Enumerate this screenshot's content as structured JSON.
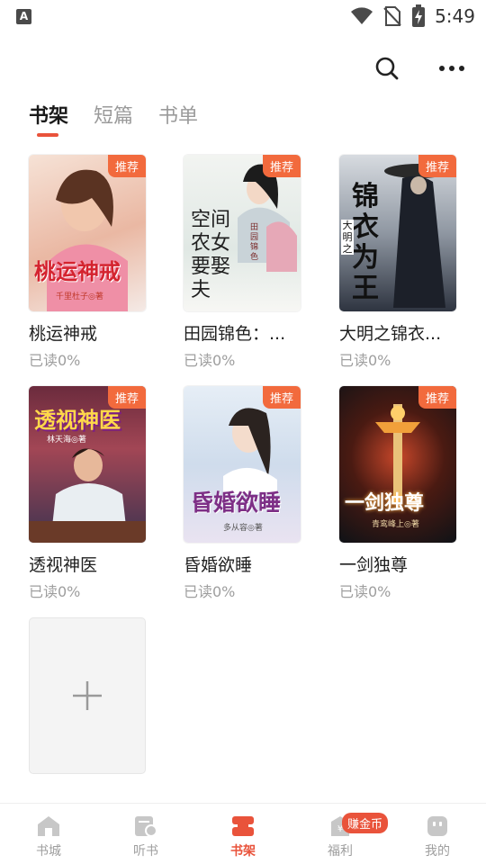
{
  "status_bar": {
    "time": "5:49",
    "left_icon": "A"
  },
  "header": {
    "search_icon": "search-icon",
    "more_icon": "more-icon"
  },
  "tabs": [
    {
      "label": "书架",
      "active": true
    },
    {
      "label": "短篇",
      "active": false
    },
    {
      "label": "书单",
      "active": false
    }
  ],
  "books": [
    {
      "title": "桃运神戒",
      "progress": "已读0%",
      "badge": "推荐",
      "cover_text": "桃运神戒",
      "cover_sub": "千里杜子◎著",
      "colors": [
        "#f3d7c8",
        "#e7a58f"
      ]
    },
    {
      "title": "田园锦色：...",
      "progress": "已读0%",
      "badge": "推荐",
      "cover_text": "空间农女要娶夫",
      "cover_sub": "田园锦色",
      "colors": [
        "#eef2ef",
        "#c9d6d1"
      ]
    },
    {
      "title": "大明之锦衣...",
      "progress": "已读0%",
      "badge": "推荐",
      "cover_text": "锦衣为王",
      "cover_sub": "大明之",
      "colors": [
        "#c7ccd3",
        "#3c4350"
      ]
    },
    {
      "title": "透视神医",
      "progress": "已读0%",
      "badge": "推荐",
      "cover_text": "透视神医",
      "cover_sub": "林天海◎著",
      "colors": [
        "#c04a59",
        "#35304f"
      ]
    },
    {
      "title": "昏婚欲睡",
      "progress": "已读0%",
      "badge": "推荐",
      "cover_text": "昏婚欲睡",
      "cover_sub": "多从容◎著",
      "colors": [
        "#dbe6f2",
        "#b3a3c9"
      ]
    },
    {
      "title": "一剑独尊",
      "progress": "已读0%",
      "badge": "推荐",
      "cover_text": "一剑独尊",
      "cover_sub": "青鸾峰上◎著",
      "colors": [
        "#5b1e12",
        "#111418"
      ]
    }
  ],
  "add_button": {
    "icon": "plus-icon"
  },
  "bottom_nav": [
    {
      "label": "书城",
      "icon": "home-icon",
      "active": false
    },
    {
      "label": "听书",
      "icon": "audio-icon",
      "active": false
    },
    {
      "label": "书架",
      "icon": "bookshelf-icon",
      "active": true
    },
    {
      "label": "福利",
      "icon": "gift-icon",
      "active": false,
      "badge": "赚金币"
    },
    {
      "label": "我的",
      "icon": "profile-icon",
      "active": false
    }
  ],
  "accent_color": "#e9533b"
}
